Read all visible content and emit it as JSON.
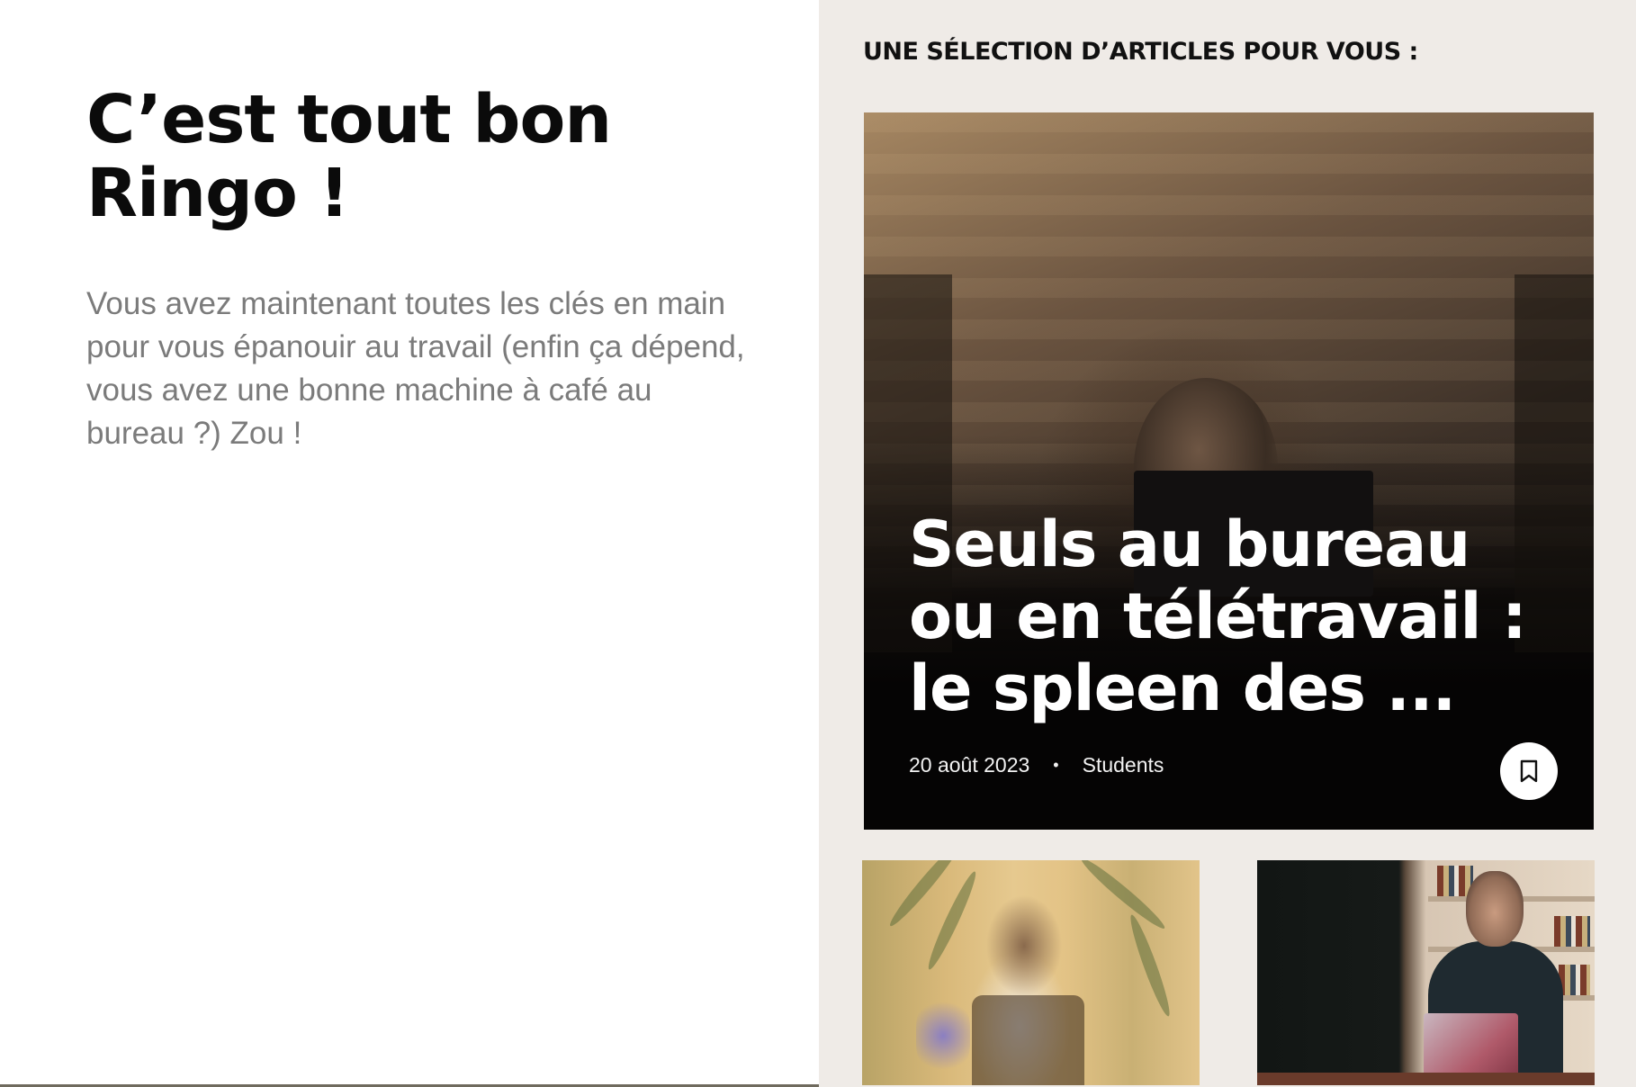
{
  "left": {
    "title": "C’est tout bon Ringo !",
    "description": "Vous avez maintenant toutes les clés en main pour vous épanouir au travail (enfin ça dépend, vous avez une bonne machine à café au bureau ?) Zou !"
  },
  "right": {
    "heading": "UNE SÉLECTION D’ARTICLES POUR VOUS :",
    "featured": {
      "title": "Seuls au bureau ou en télétravail : le spleen des ...",
      "date": "20 août 2023",
      "separator": "•",
      "category": "Students",
      "bookmark_icon": "bookmark-icon"
    },
    "cards": [
      {
        "image": "woman-in-chair-photo"
      },
      {
        "image": "man-with-laptop-photo"
      }
    ]
  },
  "colors": {
    "right_background": "#efebe7",
    "title_color": "#0b0b0b",
    "description_color": "#7b7b7b"
  }
}
